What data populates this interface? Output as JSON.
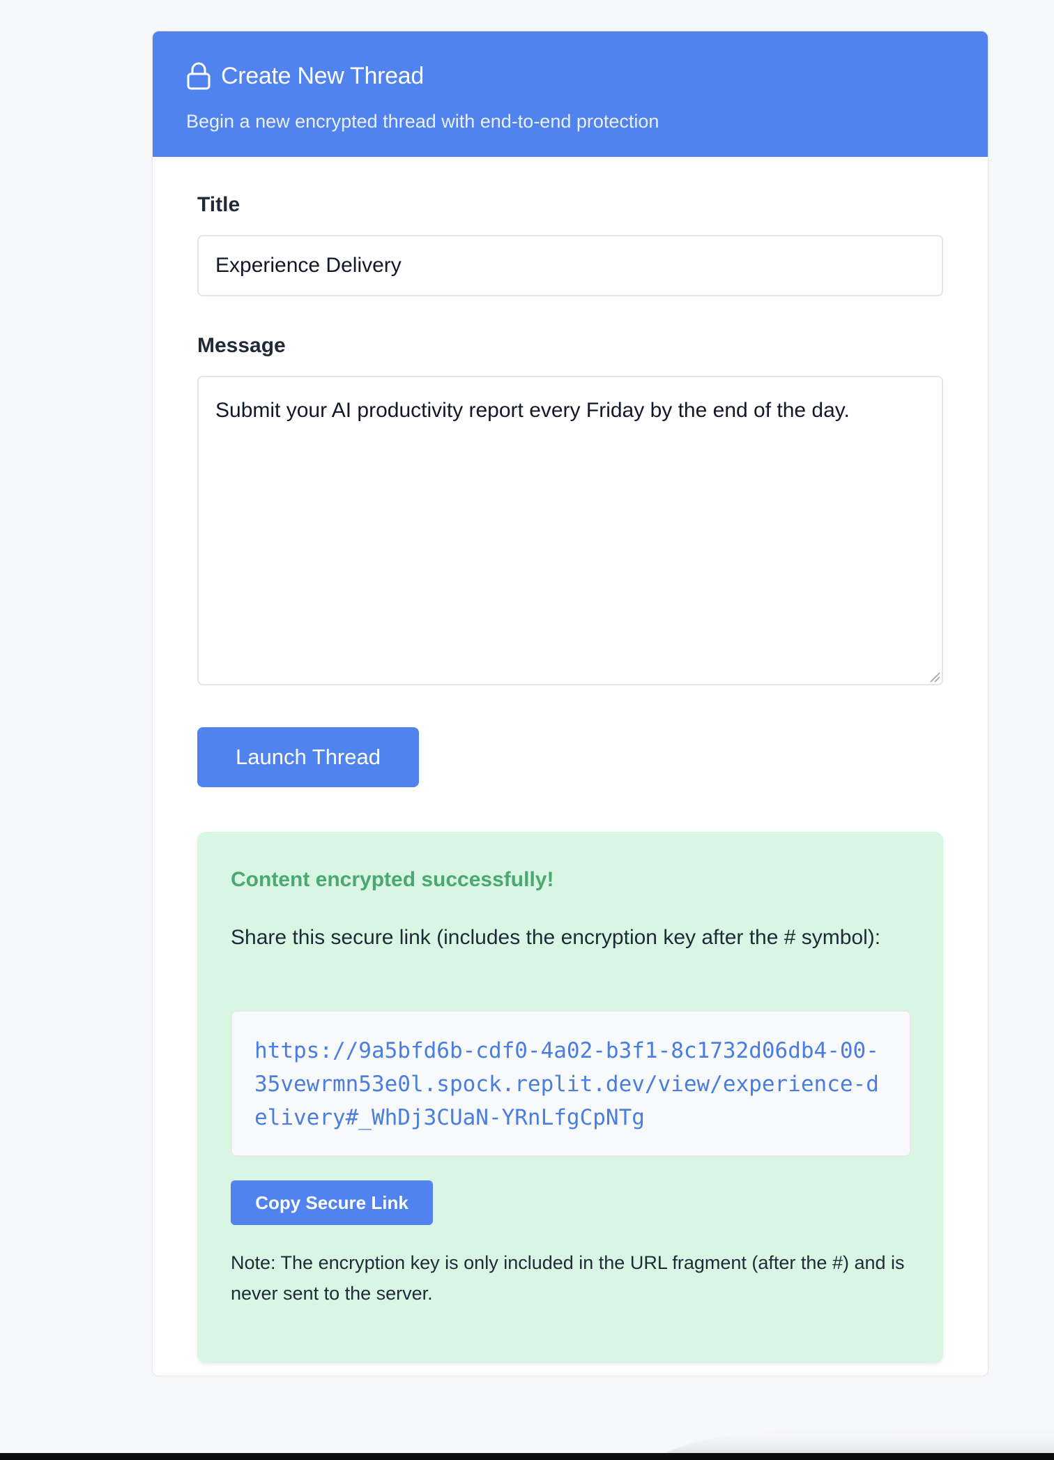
{
  "header": {
    "title": "Create New Thread",
    "subtitle": "Begin a new encrypted thread with end-to-end protection",
    "icon": "lock-icon",
    "color": "#5083ed"
  },
  "form": {
    "title_label": "Title",
    "title_value": "Experience Delivery",
    "message_label": "Message",
    "message_value": "Submit your AI productivity report every Friday by the end of the day.",
    "submit_label": "Launch Thread"
  },
  "result": {
    "heading": "Content encrypted successfully!",
    "share_text": "Share this secure link (includes the encryption key after the # symbol):",
    "link": "https://9a5bfd6b-cdf0-4a02-b3f1-8c1732d06db4-00-35vewrmn53e0l.spock.replit.dev/view/experience-delivery#_WhDj3CUaN-YRnLfgCpNTg",
    "copy_label": "Copy Secure Link",
    "note": "Note: The encryption key is only included in the URL fragment (after the #) and is never sent to the server.",
    "success_color": "#4aa870",
    "box_color": "#d9f6e5"
  }
}
